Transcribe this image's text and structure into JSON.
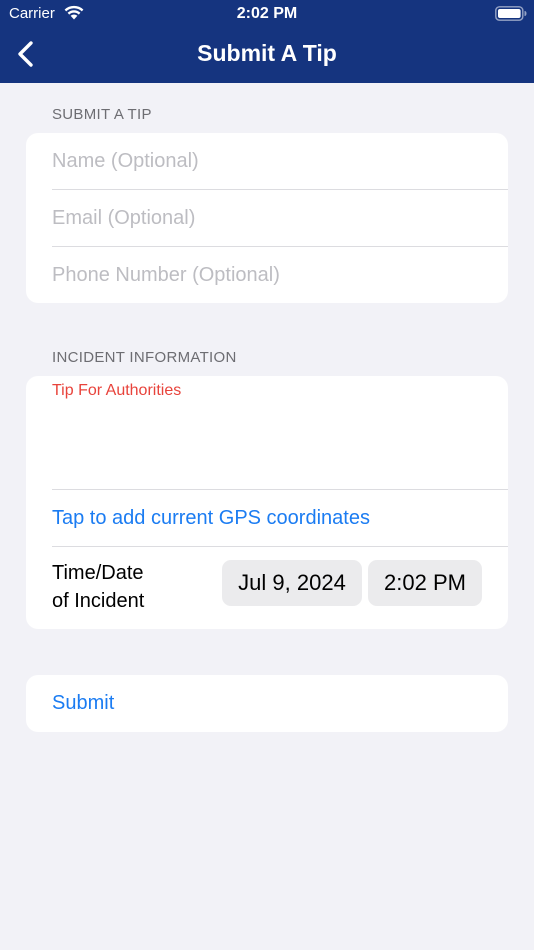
{
  "status_bar": {
    "carrier": "Carrier",
    "time": "2:02 PM"
  },
  "nav": {
    "title": "Submit A Tip",
    "back_icon": "chevron-left-icon"
  },
  "tip_section": {
    "header": "SUBMIT A TIP",
    "name_placeholder": "Name (Optional)",
    "email_placeholder": "Email (Optional)",
    "phone_placeholder": "Phone Number (Optional)"
  },
  "incident_section": {
    "header": "INCIDENT INFORMATION",
    "tip_label": "Tip For Authorities",
    "gps_link": "Tap to add current GPS coordinates",
    "time_label_line1": "Time/Date",
    "time_label_line2": "of Incident",
    "date_value": "Jul 9, 2024",
    "time_value": "2:02 PM"
  },
  "submit": {
    "label": "Submit"
  },
  "colors": {
    "nav_background": "#15347f",
    "link": "#1b7cf2",
    "tip_label": "#e8433b",
    "page_background": "#f2f2f7"
  }
}
